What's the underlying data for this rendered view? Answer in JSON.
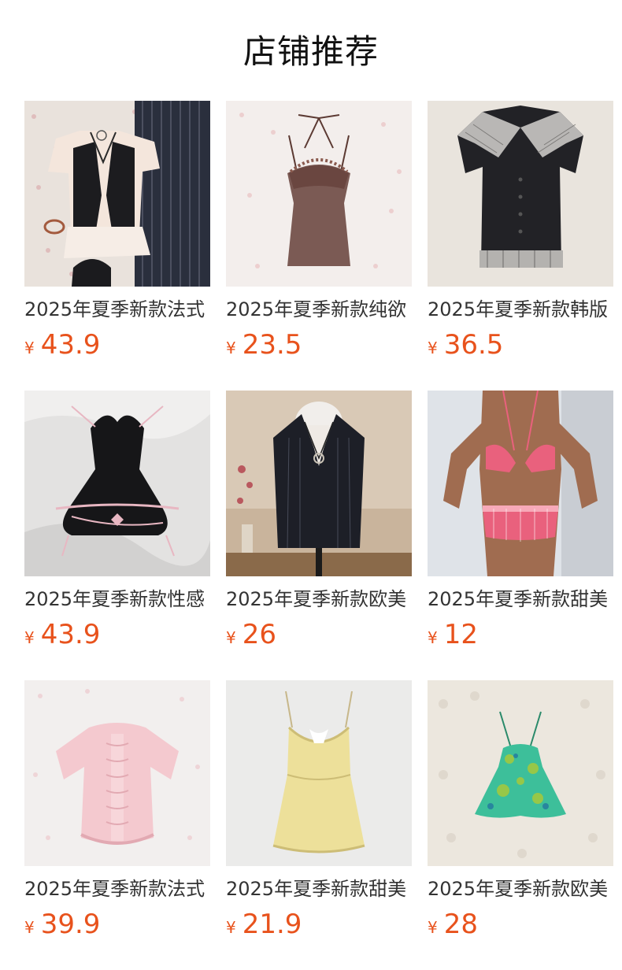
{
  "header": {
    "title": "店铺推荐"
  },
  "products": [
    {
      "title": "2025年夏季新款法式",
      "currency": "¥",
      "price": "43.9",
      "image": "vest-and-blouse-outfit"
    },
    {
      "title": "2025年夏季新款纯欲",
      "currency": "¥",
      "price": "23.5",
      "image": "brown-halter-camisole"
    },
    {
      "title": "2025年夏季新款韩版",
      "currency": "¥",
      "price": "36.5",
      "image": "plaid-collar-black-top"
    },
    {
      "title": "2025年夏季新款性感",
      "currency": "¥",
      "price": "43.9",
      "image": "black-lace-bustier-dress"
    },
    {
      "title": "2025年夏季新款欧美",
      "currency": "¥",
      "price": "26",
      "image": "pinstripe-vest-on-mannequin"
    },
    {
      "title": "2025年夏季新款甜美",
      "currency": "¥",
      "price": "12",
      "image": "pink-gingham-bikini"
    },
    {
      "title": "2025年夏季新款法式",
      "currency": "¥",
      "price": "39.9",
      "image": "pink-ruffle-top"
    },
    {
      "title": "2025年夏季新款甜美",
      "currency": "¥",
      "price": "21.9",
      "image": "yellow-camisole"
    },
    {
      "title": "2025年夏季新款欧美",
      "currency": "¥",
      "price": "28",
      "image": "green-print-halter-dress"
    }
  ]
}
